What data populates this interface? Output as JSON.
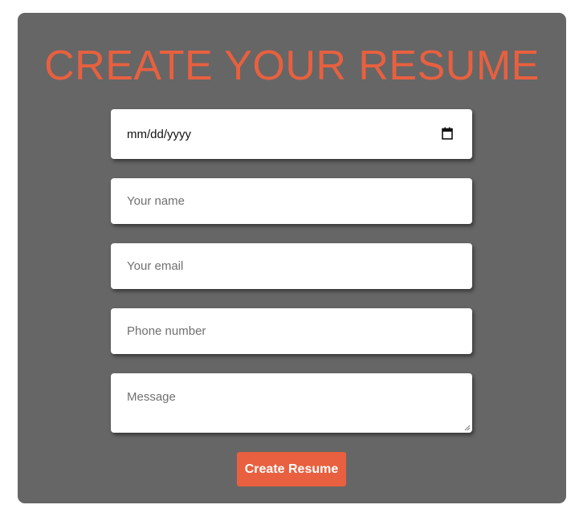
{
  "page": {
    "title": "CREATE YOUR RESUME"
  },
  "form": {
    "date_value": "mm/dd/yyyy",
    "name_placeholder": "Your name",
    "email_placeholder": "Your email",
    "phone_placeholder": "Phone number",
    "message_placeholder": "Message",
    "submit_label": "Create Resume"
  },
  "colors": {
    "card_background": "#666666",
    "accent": "#e8603f",
    "field_background": "#ffffff"
  },
  "icons": {
    "date_picker": "calendar-icon",
    "textarea_resize": "resize-grip-icon"
  }
}
